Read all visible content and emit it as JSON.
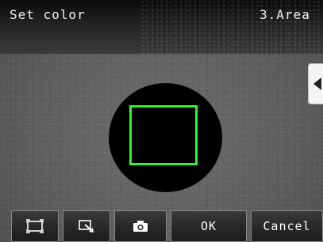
{
  "header": {
    "title": "Set color",
    "area_label": "3.Area"
  },
  "side_tab": {
    "icon": "chevron-left-icon"
  },
  "toolbar": {
    "buttons": [
      {
        "name": "fit-view-button",
        "icon": "frame-icon"
      },
      {
        "name": "zoom-select-button",
        "icon": "zoom-region-icon"
      },
      {
        "name": "capture-button",
        "icon": "camera-icon"
      },
      {
        "name": "ok-button",
        "label": "OK"
      },
      {
        "name": "cancel-button",
        "label": "Cancel"
      }
    ]
  },
  "colors": {
    "roi_outline": "#2ff52f",
    "mask": "#000000",
    "text": "#ffffff"
  }
}
